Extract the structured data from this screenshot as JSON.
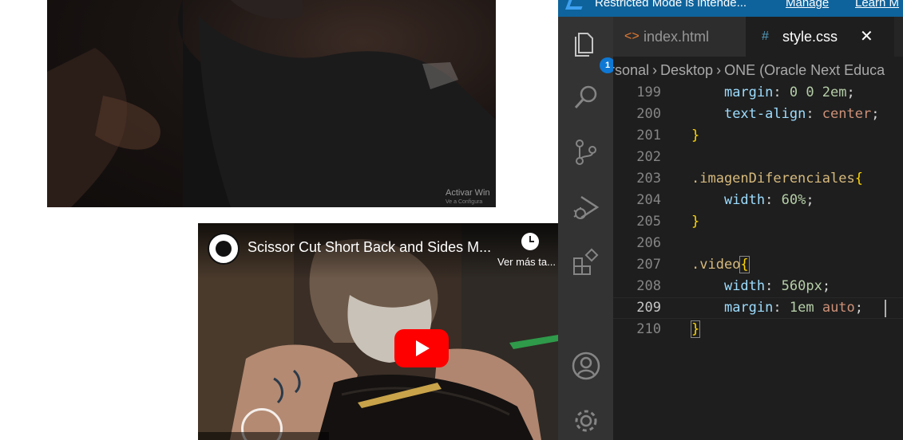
{
  "browser": {
    "watermark_line1": "Activar Win",
    "watermark_line2": "Ve a Configura",
    "video": {
      "title": "Scissor Cut Short Back and Sides M...",
      "watch_later": "Ver más ta..."
    }
  },
  "vscode": {
    "banner": {
      "message": "Restricted Mode is intende...",
      "manage": "Manage",
      "learn_more": "Learn M"
    },
    "activity_bar": {
      "explorer_badge": "1",
      "icons": [
        "files-icon",
        "search-icon",
        "source-control-icon",
        "run-debug-icon",
        "extensions-icon",
        "account-icon",
        "settings-gear-icon"
      ]
    },
    "tabs": [
      {
        "label": "index.html",
        "icon": "<>",
        "active": false
      },
      {
        "label": "style.css",
        "icon": "#",
        "active": true,
        "close": "✕"
      }
    ],
    "breadcrumb": [
      "rsonal",
      "Desktop",
      "ONE (Oracle Next Educa"
    ],
    "editor": {
      "lines": [
        {
          "num": "199",
          "tokens": [
            {
              "t": "    ",
              "c": "t-punct"
            },
            {
              "t": "margin",
              "c": "t-prop"
            },
            {
              "t": ": ",
              "c": "t-punct"
            },
            {
              "t": "0 0 2em",
              "c": "t-val"
            },
            {
              "t": ";",
              "c": "t-punct"
            }
          ]
        },
        {
          "num": "200",
          "tokens": [
            {
              "t": "    ",
              "c": "t-punct"
            },
            {
              "t": "text-align",
              "c": "t-prop"
            },
            {
              "t": ": ",
              "c": "t-punct"
            },
            {
              "t": "center",
              "c": "t-kw"
            },
            {
              "t": ";",
              "c": "t-punct"
            }
          ]
        },
        {
          "num": "201",
          "tokens": [
            {
              "t": "}",
              "c": "t-brace"
            }
          ]
        },
        {
          "num": "202",
          "tokens": []
        },
        {
          "num": "203",
          "tokens": [
            {
              "t": ".imagenDiferenciales",
              "c": "t-sel"
            },
            {
              "t": "{",
              "c": "t-brace"
            }
          ]
        },
        {
          "num": "204",
          "tokens": [
            {
              "t": "    ",
              "c": "t-punct"
            },
            {
              "t": "width",
              "c": "t-prop"
            },
            {
              "t": ": ",
              "c": "t-punct"
            },
            {
              "t": "60%",
              "c": "t-val"
            },
            {
              "t": ";",
              "c": "t-punct"
            }
          ]
        },
        {
          "num": "205",
          "tokens": [
            {
              "t": "}",
              "c": "t-brace"
            }
          ]
        },
        {
          "num": "206",
          "tokens": []
        },
        {
          "num": "207",
          "tokens": [
            {
              "t": ".video",
              "c": "t-sel"
            },
            {
              "t": "{",
              "c": "t-brace brace-match"
            }
          ]
        },
        {
          "num": "208",
          "tokens": [
            {
              "t": "    ",
              "c": "t-punct"
            },
            {
              "t": "width",
              "c": "t-prop"
            },
            {
              "t": ": ",
              "c": "t-punct"
            },
            {
              "t": "560px",
              "c": "t-val"
            },
            {
              "t": ";",
              "c": "t-punct"
            }
          ]
        },
        {
          "num": "209",
          "active": true,
          "tokens": [
            {
              "t": "    ",
              "c": "t-punct"
            },
            {
              "t": "margin",
              "c": "t-prop"
            },
            {
              "t": ": ",
              "c": "t-punct"
            },
            {
              "t": "1em",
              "c": "t-val"
            },
            {
              "t": " ",
              "c": "t-punct"
            },
            {
              "t": "auto",
              "c": "t-kw"
            },
            {
              "t": ";",
              "c": "t-punct"
            }
          ]
        },
        {
          "num": "210",
          "tokens": [
            {
              "t": "}",
              "c": "t-brace brace-match"
            }
          ]
        }
      ]
    }
  },
  "colors": {
    "banner": "#0e639c",
    "activity_bar": "#333333",
    "editor_bg": "#1e1e1e",
    "youtube_red": "#ff0000",
    "badge": "#0e78d4"
  }
}
